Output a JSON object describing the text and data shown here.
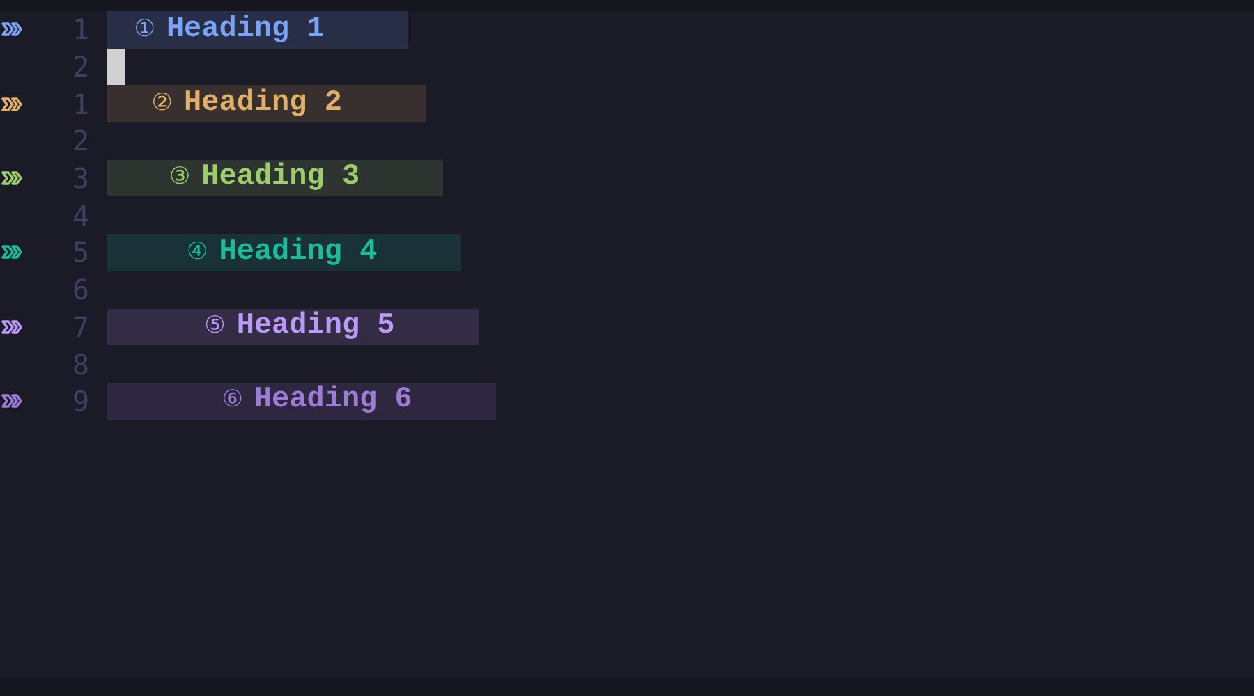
{
  "lines": [
    {
      "number": "1",
      "kind": "heading",
      "marker": "①",
      "text": "Heading 1",
      "color": "#7aa2f7",
      "cursor": false
    },
    {
      "number": "2",
      "kind": "empty",
      "cursor": true
    },
    {
      "number": "1",
      "kind": "heading",
      "marker": "②",
      "text": "Heading 2",
      "color": "#e0af68",
      "cursor": false
    },
    {
      "number": "2",
      "kind": "empty",
      "cursor": false
    },
    {
      "number": "3",
      "kind": "heading",
      "marker": "③",
      "text": "Heading 3",
      "color": "#9ece6a",
      "cursor": false
    },
    {
      "number": "4",
      "kind": "empty",
      "cursor": false
    },
    {
      "number": "5",
      "kind": "heading",
      "marker": "④",
      "text": "Heading 4",
      "color": "#1abc9c",
      "cursor": false
    },
    {
      "number": "6",
      "kind": "empty",
      "cursor": false
    },
    {
      "number": "7",
      "kind": "heading",
      "marker": "⑤",
      "text": "Heading 5",
      "color": "#bb9af7",
      "cursor": false
    },
    {
      "number": "8",
      "kind": "empty",
      "cursor": false
    },
    {
      "number": "9",
      "kind": "heading",
      "marker": "⑥",
      "text": "Heading 6",
      "color": "#9d7cd8",
      "cursor": false
    }
  ]
}
